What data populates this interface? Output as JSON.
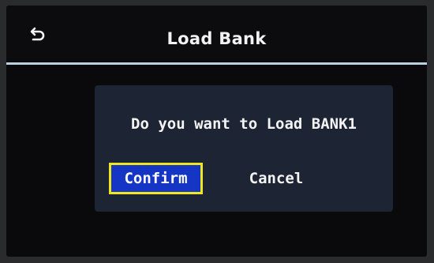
{
  "header": {
    "back_icon": "back-arrow-icon",
    "title": "Load Bank"
  },
  "dialog": {
    "message": "Do you want to Load BANK1",
    "confirm_label": "Confirm",
    "cancel_label": "Cancel",
    "selected": "Confirm"
  },
  "colors": {
    "divider": "#b7d3e0",
    "dialog_bg": "#1d2434",
    "selected_button_bg": "#1535c4",
    "focus_border": "#f0e61e"
  }
}
